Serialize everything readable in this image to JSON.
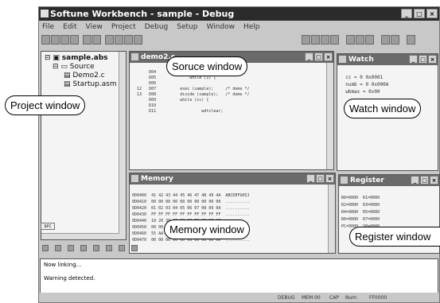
{
  "window": {
    "title": "Softune Workbench - sample - Debug"
  },
  "menu": [
    "File",
    "Edit",
    "View",
    "Project",
    "Debug",
    "Setup",
    "Window",
    "Help"
  ],
  "project": {
    "root": "sample.abs",
    "folder": "Source",
    "files": [
      "Demo2.c",
      "Startup.asm"
    ],
    "tab": "src"
  },
  "source_window": {
    "title": "demo2.c",
    "lines": [
      "       D04              char s = 0;",
      "       D05              while (1) {",
      "       D06",
      "  12   D07          exec (sample);     /* demo */",
      "  13   D08          divide (sample);   /* demo */",
      "       D09          while (cc) {",
      "       D10",
      "       D11                   wdtclear;"
    ]
  },
  "watch_window": {
    "title": "Watch",
    "lines": [
      "  cc = 0 0x0001",
      "  numb = 0 0x000A",
      "  wbmax = 0x00"
    ]
  },
  "memory_window": {
    "title": "Memory",
    "rows": [
      "0D0400  41 42 43 44 45 46 47 48 49 4A  ABCDEFGHIJ",
      "0D0410  00 00 00 00 00 00 00 00 00 00  ..........",
      "0D0420  01 02 03 04 05 06 07 08 09 0A  ..........",
      "0D0430  FF FF FF FF FF FF FF FF FF FF  ..........",
      "0D0440  10 20 30 40 50 60 70 80 90 A0  ..........",
      "0D0450  00 00 00 00 00 00 00 00 00 00  ..........",
      "0D0460  55 AA 55 AA 55 AA 55 AA 55 AA  U.U.U.U.U.",
      "0D0470  00 00 00 00 00 00 00 00 00 00  .........."
    ]
  },
  "register_window": {
    "title": "Register",
    "rows": [
      "R0=0000  R1=0000",
      "R2=0000  R3=0000",
      "R4=0000  R5=0000",
      "R6=0000  R7=0000",
      "PC=0000  SP=0000"
    ]
  },
  "output_window": {
    "lines": [
      "Now linking...",
      "",
      "Warning detected."
    ]
  },
  "status_bar": {
    "items": [
      "DEBUG",
      "MEM 00",
      "CAP",
      "Num",
      "FF0000"
    ]
  },
  "callouts": {
    "project": "Project window",
    "source": "Soruce window",
    "watch": "Watch window",
    "memory": "Memory window",
    "register": "Register window"
  }
}
